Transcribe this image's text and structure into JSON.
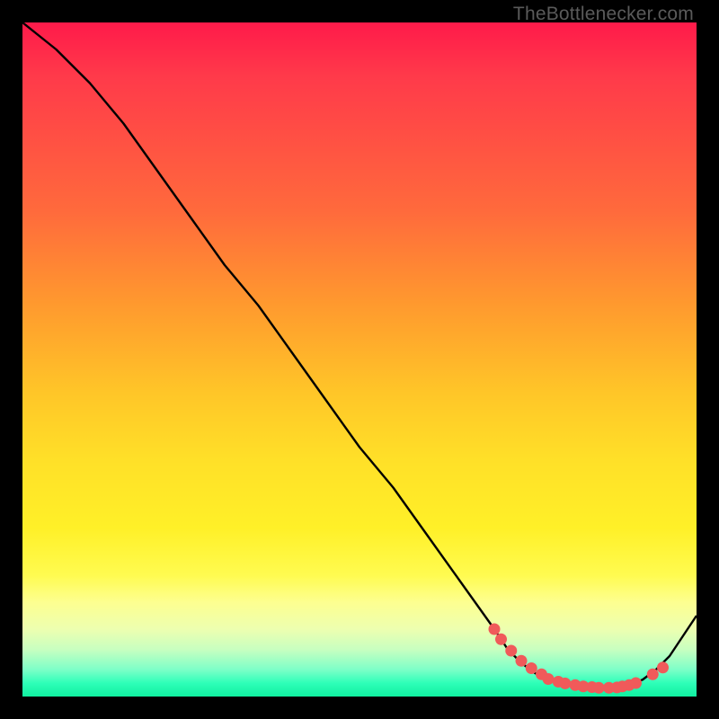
{
  "attribution": "TheBottlenecker.com",
  "chart_data": {
    "type": "line",
    "title": "",
    "xlabel": "",
    "ylabel": "",
    "xlim": [
      0,
      100
    ],
    "ylim": [
      0,
      100
    ],
    "x": [
      0,
      5,
      10,
      15,
      20,
      25,
      30,
      35,
      40,
      45,
      50,
      55,
      60,
      65,
      70,
      72,
      74,
      76,
      78,
      80,
      82,
      84,
      86,
      88,
      90,
      92,
      94,
      96,
      98,
      100
    ],
    "values": [
      100,
      96,
      91,
      85,
      78,
      71,
      64,
      58,
      51,
      44,
      37,
      31,
      24,
      17,
      10,
      7,
      5,
      3.5,
      2.5,
      2,
      1.6,
      1.3,
      1.2,
      1.3,
      1.7,
      2.5,
      4,
      6,
      9,
      12
    ],
    "marker_segments": [
      {
        "x": [
          70,
          71,
          72.5,
          74,
          75.5,
          77
        ],
        "y": [
          10.0,
          8.5,
          6.8,
          5.3,
          4.2,
          3.3
        ]
      },
      {
        "x": [
          78,
          79.5,
          80.5,
          82,
          83.2,
          84.5,
          85.5,
          87,
          88.2,
          89,
          90,
          91
        ],
        "y": [
          2.6,
          2.2,
          1.95,
          1.7,
          1.5,
          1.4,
          1.3,
          1.3,
          1.35,
          1.5,
          1.7,
          2.0
        ]
      },
      {
        "x": [
          93.5,
          95
        ],
        "y": [
          3.3,
          4.3
        ]
      }
    ],
    "marker_color": "#f05a5a",
    "line_color": "#000000"
  }
}
